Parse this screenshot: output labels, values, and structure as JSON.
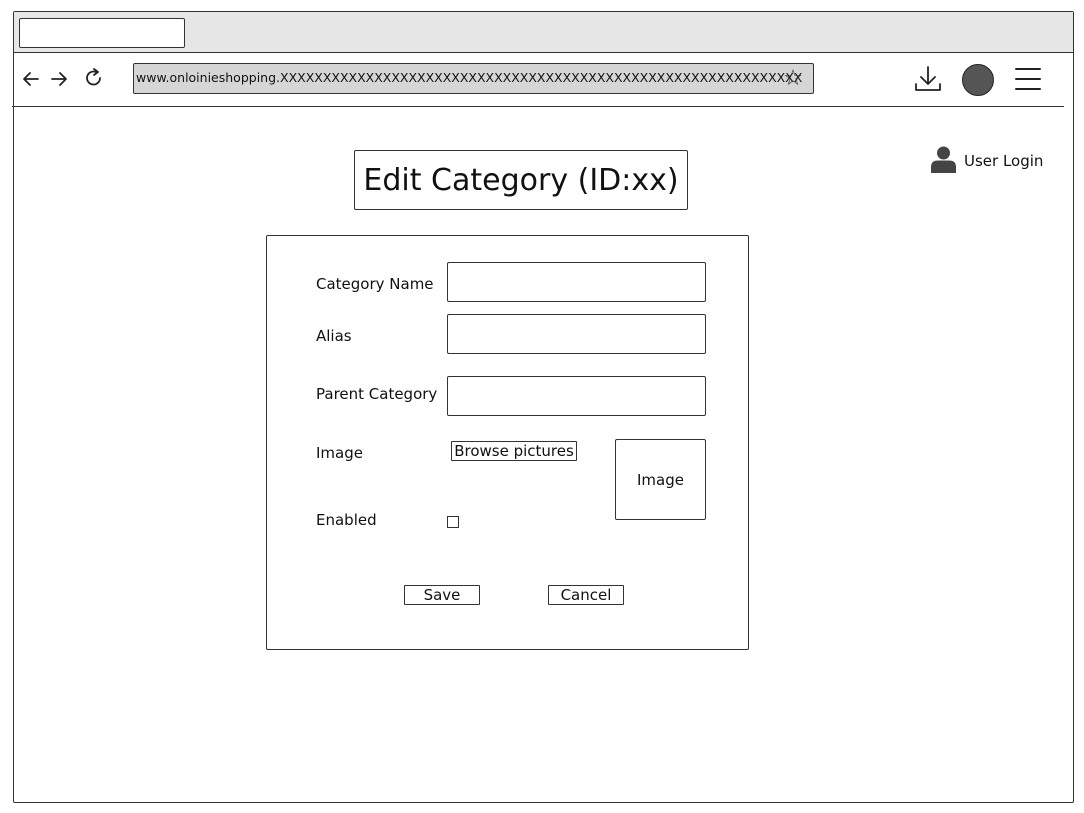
{
  "browser": {
    "tab": {
      "title": ""
    },
    "url": "www.onloinieshopping.XXXXXXXXXXXXXXXXXXXXXXXXXXXXXXXXXXXXXXXXXXXXXXXXXXXXXXXXXXXXX",
    "icons": [
      "back-arrow-icon",
      "forward-arrow-icon",
      "reload-icon",
      "star-icon",
      "download-icon",
      "profile-icon",
      "hamburger-menu-icon"
    ]
  },
  "header": {
    "user_login": "User Login"
  },
  "page": {
    "title": "Edit Category (ID:xx)"
  },
  "form": {
    "category_name": {
      "label": "Category Name",
      "value": ""
    },
    "alias": {
      "label": "Alias",
      "value": ""
    },
    "parent_category": {
      "label": "Parent Category",
      "value": ""
    },
    "image": {
      "label": "Image",
      "browse_label": "Browse pictures",
      "preview_label": "Image"
    },
    "enabled": {
      "label": "Enabled",
      "checked": false
    },
    "save_label": "Save",
    "cancel_label": "Cancel"
  }
}
